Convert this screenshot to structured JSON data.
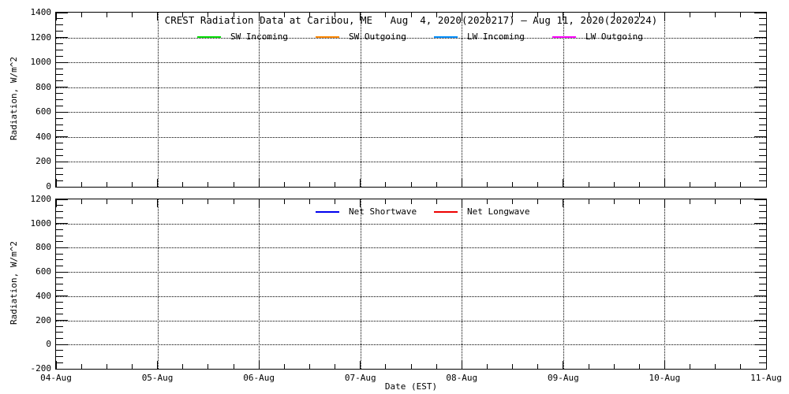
{
  "figure": {
    "title": "CREST Radiation Data at Caribou, ME   Aug  4, 2020(2020217) – Aug 11, 2020(2020224)",
    "xlabel": "Date (EST)",
    "background_color": "#ffffff",
    "axis_color": "#000000"
  },
  "axes": {
    "x": {
      "tick_labels": [
        "04-Aug",
        "05-Aug",
        "06-Aug",
        "07-Aug",
        "08-Aug",
        "09-Aug",
        "10-Aug",
        "11-Aug"
      ],
      "days": 7,
      "minors_per_day": 4
    },
    "top": {
      "ylabel": "Radiation, W/m^2",
      "ymin": 0,
      "ymax": 1400,
      "major_step": 200,
      "minor_step": 50,
      "tick_labels": [
        "0",
        "200",
        "400",
        "600",
        "800",
        "1000",
        "1200",
        "1400"
      ]
    },
    "bottom": {
      "ylabel": "Radiation, W/m^2",
      "ymin": -200,
      "ymax": 1200,
      "major_step": 200,
      "minor_step": 50,
      "tick_labels": [
        "-200",
        "0",
        "200",
        "400",
        "600",
        "800",
        "1000",
        "1200"
      ]
    }
  },
  "legend_top": [
    {
      "label": "SW Incoming",
      "color": "#00dd00"
    },
    {
      "label": "SW Outgoing",
      "color": "#ff8800"
    },
    {
      "label": "LW Incoming",
      "color": "#0090ff"
    },
    {
      "label": "LW Outgoing",
      "color": "#ff00ff"
    }
  ],
  "legend_bottom": [
    {
      "label": "Net Shortwave",
      "color": "#0000ee"
    },
    {
      "label": "Net Longwave",
      "color": "#ee0000"
    }
  ],
  "chart_data": [
    {
      "type": "line",
      "title": "CREST Radiation Data at Caribou, ME   Aug  4, 2020(2020217) – Aug 11, 2020(2020224)",
      "xlabel": "Date (EST)",
      "ylabel": "Radiation, W/m^2",
      "x_tick_labels": [
        "04-Aug",
        "05-Aug",
        "06-Aug",
        "07-Aug",
        "08-Aug",
        "09-Aug",
        "10-Aug",
        "11-Aug"
      ],
      "ylim": [
        0,
        1400
      ],
      "y_ticks": [
        0,
        200,
        400,
        600,
        800,
        1000,
        1200,
        1400
      ],
      "grid": true,
      "legend_position": "top-inside",
      "series": [
        {
          "name": "SW Incoming",
          "color": "#00dd00",
          "values": []
        },
        {
          "name": "SW Outgoing",
          "color": "#ff8800",
          "values": []
        },
        {
          "name": "LW Incoming",
          "color": "#0090ff",
          "values": []
        },
        {
          "name": "LW Outgoing",
          "color": "#ff00ff",
          "values": []
        }
      ],
      "note": "axes, grid and legend drawn but no data traces visible for this period"
    },
    {
      "type": "line",
      "title": "",
      "xlabel": "Date (EST)",
      "ylabel": "Radiation, W/m^2",
      "x_tick_labels": [
        "04-Aug",
        "05-Aug",
        "06-Aug",
        "07-Aug",
        "08-Aug",
        "09-Aug",
        "10-Aug",
        "11-Aug"
      ],
      "ylim": [
        -200,
        1200
      ],
      "y_ticks": [
        -200,
        0,
        200,
        400,
        600,
        800,
        1000,
        1200
      ],
      "grid": true,
      "legend_position": "top-inside",
      "series": [
        {
          "name": "Net Shortwave",
          "color": "#0000ee",
          "values": []
        },
        {
          "name": "Net Longwave",
          "color": "#ee0000",
          "values": []
        }
      ],
      "note": "axes, grid and legend drawn but no data traces visible for this period"
    }
  ]
}
